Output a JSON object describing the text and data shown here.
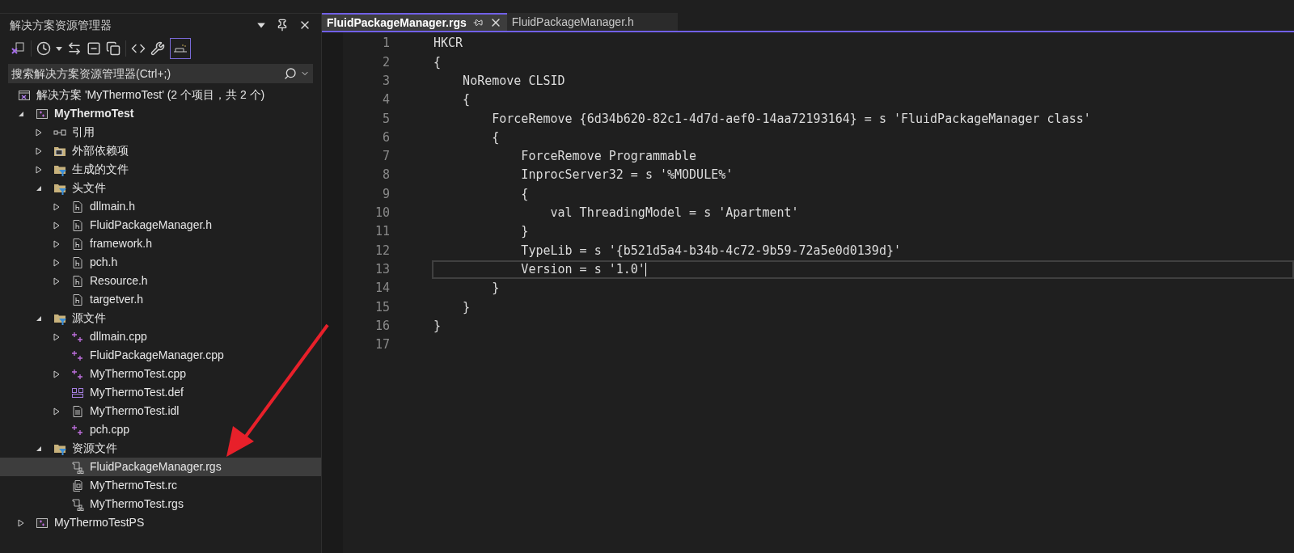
{
  "explorer": {
    "title": "解决方案资源管理器",
    "search": {
      "placeholder": "搜索解决方案资源管理器(Ctrl+;)"
    },
    "tree": [
      {
        "label": "解决方案 'MyThermoTest' (2 个项目，共 2 个)",
        "kind": "solution",
        "selected": false,
        "bold": false,
        "children": [
          {
            "label": "MyThermoTest",
            "kind": "project",
            "expanded": true,
            "selected": false,
            "bold": true,
            "children": [
              {
                "label": "引用",
                "kind": "references",
                "expanded": false,
                "selected": false,
                "bold": false
              },
              {
                "label": "外部依赖项",
                "kind": "external",
                "expanded": false,
                "selected": false,
                "bold": false
              },
              {
                "label": "生成的文件",
                "kind": "filter",
                "expanded": false,
                "selected": false,
                "bold": false
              },
              {
                "label": "头文件",
                "kind": "filter",
                "expanded": true,
                "selected": false,
                "bold": false,
                "children": [
                  {
                    "label": "dllmain.h",
                    "kind": "header",
                    "expanded": false,
                    "selected": false,
                    "bold": false
                  },
                  {
                    "label": "FluidPackageManager.h",
                    "kind": "header",
                    "expanded": false,
                    "selected": false,
                    "bold": false
                  },
                  {
                    "label": "framework.h",
                    "kind": "header",
                    "expanded": false,
                    "selected": false,
                    "bold": false
                  },
                  {
                    "label": "pch.h",
                    "kind": "header",
                    "expanded": false,
                    "selected": false,
                    "bold": false
                  },
                  {
                    "label": "Resource.h",
                    "kind": "header",
                    "expanded": false,
                    "selected": false,
                    "bold": false
                  },
                  {
                    "label": "targetver.h",
                    "kind": "header",
                    "selected": false,
                    "bold": false
                  }
                ]
              },
              {
                "label": "源文件",
                "kind": "filter",
                "expanded": true,
                "selected": false,
                "bold": false,
                "children": [
                  {
                    "label": "dllmain.cpp",
                    "kind": "cpp",
                    "expanded": false,
                    "selected": false,
                    "bold": false
                  },
                  {
                    "label": "FluidPackageManager.cpp",
                    "kind": "cpp",
                    "selected": false,
                    "bold": false
                  },
                  {
                    "label": "MyThermoTest.cpp",
                    "kind": "cpp",
                    "expanded": false,
                    "selected": false,
                    "bold": false
                  },
                  {
                    "label": "MyThermoTest.def",
                    "kind": "def",
                    "selected": false,
                    "bold": false
                  },
                  {
                    "label": "MyThermoTest.idl",
                    "kind": "idl",
                    "expanded": false,
                    "selected": false,
                    "bold": false
                  },
                  {
                    "label": "pch.cpp",
                    "kind": "cpp",
                    "selected": false,
                    "bold": false
                  }
                ]
              },
              {
                "label": "资源文件",
                "kind": "filter",
                "expanded": true,
                "selected": false,
                "bold": false,
                "children": [
                  {
                    "label": "FluidPackageManager.rgs",
                    "kind": "rgs",
                    "selected": true,
                    "bold": false
                  },
                  {
                    "label": "MyThermoTest.rc",
                    "kind": "rc",
                    "selected": false,
                    "bold": false
                  },
                  {
                    "label": "MyThermoTest.rgs",
                    "kind": "rgs",
                    "selected": false,
                    "bold": false
                  }
                ]
              }
            ]
          },
          {
            "label": "MyThermoTestPS",
            "kind": "project",
            "expanded": false,
            "selected": false,
            "bold": false
          }
        ]
      }
    ]
  },
  "editor": {
    "tabs": [
      {
        "label": "FluidPackageManager.rgs",
        "selected": true
      },
      {
        "label": "FluidPackageManager.h",
        "selected": false
      }
    ],
    "lines": [
      {
        "number": "1",
        "text": "HKCR",
        "current": false
      },
      {
        "number": "2",
        "text": "{",
        "current": false
      },
      {
        "number": "3",
        "text": "    NoRemove CLSID",
        "current": false
      },
      {
        "number": "4",
        "text": "    {",
        "current": false
      },
      {
        "number": "5",
        "text": "        ForceRemove {6d34b620-82c1-4d7d-aef0-14aa72193164} = s 'FluidPackageManager class'",
        "current": false
      },
      {
        "number": "6",
        "text": "        {",
        "current": false
      },
      {
        "number": "7",
        "text": "            ForceRemove Programmable",
        "current": false
      },
      {
        "number": "8",
        "text": "            InprocServer32 = s '%MODULE%'",
        "current": false
      },
      {
        "number": "9",
        "text": "            {",
        "current": false
      },
      {
        "number": "10",
        "text": "                val ThreadingModel = s 'Apartment'",
        "current": false
      },
      {
        "number": "11",
        "text": "            }",
        "current": false
      },
      {
        "number": "12",
        "text": "            TypeLib = s '{b521d5a4-b34b-4c72-9b59-72a5e0d0139d}'",
        "current": false
      },
      {
        "number": "13",
        "text": "            Version = s '1.0'",
        "current": true
      },
      {
        "number": "14",
        "text": "        }",
        "current": false
      },
      {
        "number": "15",
        "text": "    }",
        "current": false
      },
      {
        "number": "16",
        "text": "}",
        "current": false
      },
      {
        "number": "17",
        "current": false
      }
    ]
  }
}
